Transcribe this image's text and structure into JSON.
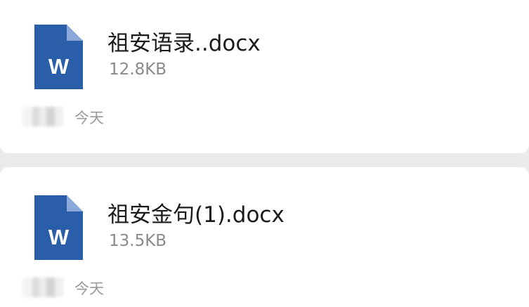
{
  "files": [
    {
      "name": "祖安语录..docx",
      "size": "12.8KB",
      "date": "今天",
      "icon": "word-doc-icon",
      "icon_letter": "W"
    },
    {
      "name": "祖安金句(1).docx",
      "size": "13.5KB",
      "date": "今天",
      "icon": "word-doc-icon",
      "icon_letter": "W"
    }
  ],
  "colors": {
    "word_blue": "#2b5ea9",
    "word_fold": "#8aa9d9",
    "background": "#ebebeb",
    "card": "#ffffff"
  }
}
